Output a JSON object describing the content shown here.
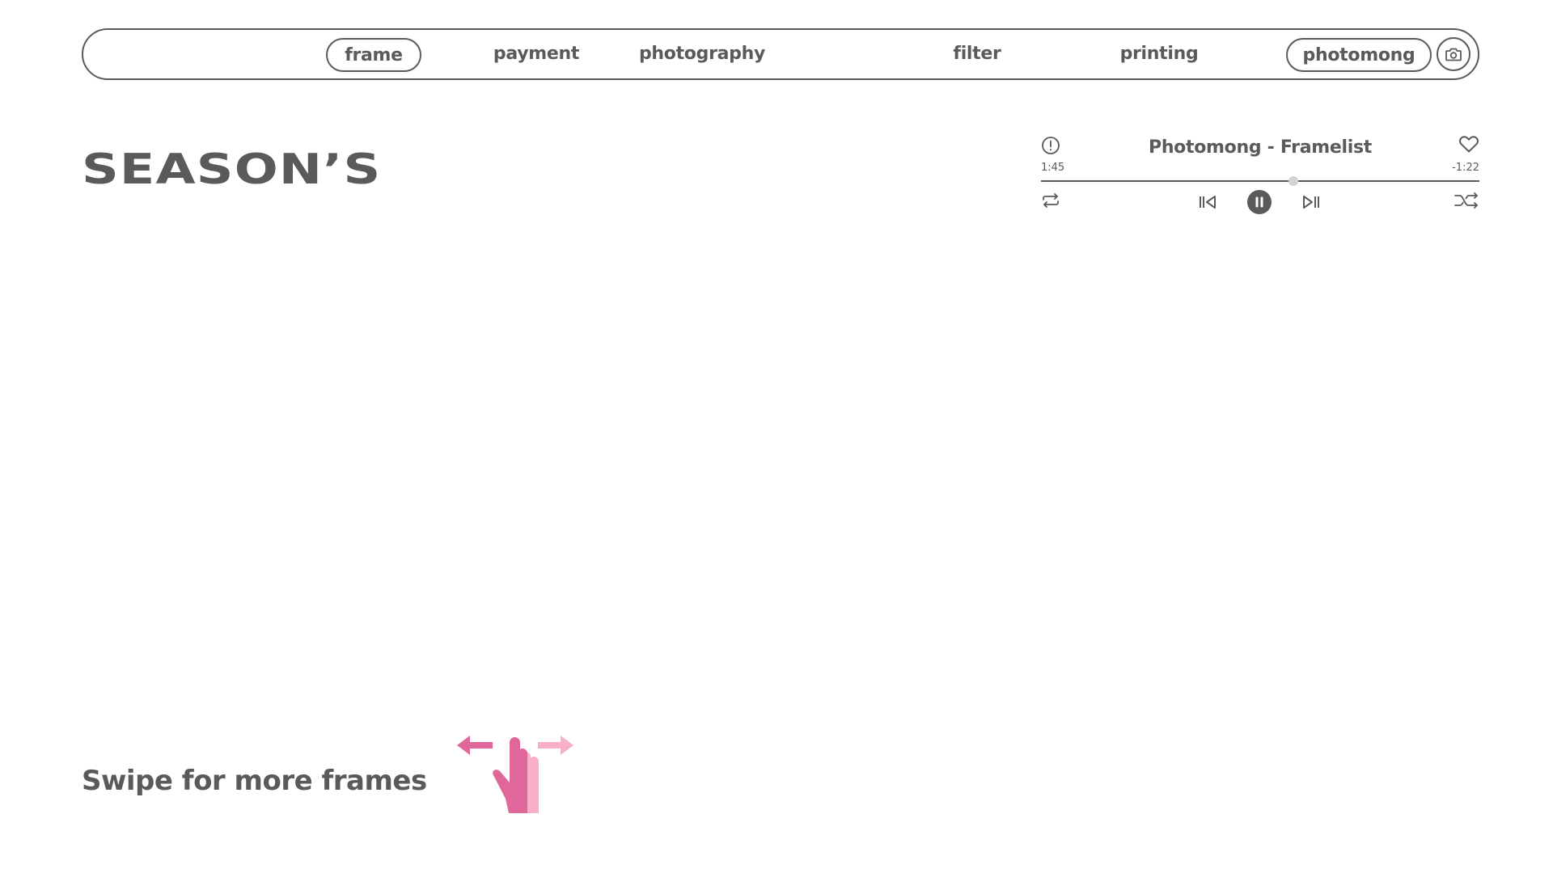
{
  "nav": {
    "items": [
      {
        "label": "frame",
        "active": true
      },
      {
        "label": "payment",
        "active": false
      },
      {
        "label": "photography",
        "active": false
      },
      {
        "label": "filter",
        "active": false
      },
      {
        "label": "printing",
        "active": false
      },
      {
        "label": "photomong",
        "active": true
      }
    ],
    "camera_icon": "camera-icon"
  },
  "title": "SEASON’S",
  "player": {
    "track_title": "Photomong - Framelist",
    "elapsed": "1:45",
    "remaining": "-1:22",
    "progress_fraction": 0.576,
    "state": "playing",
    "icons": {
      "info": "info-icon",
      "favorite": "heart-icon",
      "repeat": "repeat-icon",
      "previous": "skip-back-icon",
      "pause": "pause-icon",
      "next": "skip-forward-icon",
      "shuffle": "shuffle-icon"
    }
  },
  "swipe_hint": {
    "text": "Swipe for more frames",
    "icon": "swipe-gesture-icon"
  },
  "colors": {
    "text": "#5a5a5a",
    "accent_dark_pink": "#e0679a",
    "accent_light_pink": "#f9afc8",
    "knob": "#d3d3d3",
    "background": "#ffffff"
  }
}
